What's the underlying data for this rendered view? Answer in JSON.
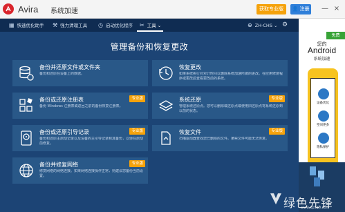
{
  "titlebar": {
    "app_name": "Avira",
    "app_subtitle": "系统加速",
    "pro_button": "获取专业版",
    "register_button": "注册",
    "minimize": "—",
    "close": "×"
  },
  "nav": {
    "items": [
      {
        "label": "快速优化助手",
        "icon": "grid-icon"
      },
      {
        "label": "强力清理工具",
        "icon": "broom-icon"
      },
      {
        "label": "启动优化程序",
        "icon": "timer-icon"
      },
      {
        "label": "工具",
        "icon": "tools-icon",
        "active": true
      }
    ],
    "language": "ZH-CHS",
    "settings_icon": "gear-icon"
  },
  "main": {
    "title": "管理备份和恢复更改",
    "cards": [
      {
        "title": "备份并还原文件或文件夹",
        "desc": "备份和还原在设备上的数据。",
        "badge": "",
        "icon": "database-icon"
      },
      {
        "title": "恢复更改",
        "desc": "如果系统执行对对计时间以删除系统加速所做的更改。在应用修复程序或更改后查看更改前的系统。",
        "badge": "",
        "icon": "restore-clock-icon"
      },
      {
        "title": "备份或还原注册表",
        "desc": "备份 Windows 注册表或返回之前的备份恢复注册表。",
        "badge": "专业版",
        "icon": "registry-icon"
      },
      {
        "title": "系统还原",
        "desc": "管理系统还原点。您可以删除或还原点或使用旧还原点将系统还原到以前的状态。",
        "badge": "专业版",
        "icon": "system-restore-icon"
      },
      {
        "title": "备份或还原引导记录",
        "desc": "备份和还原主启动记录以及设备的主引导记录和其备份，以便在启动前修复。",
        "badge": "专业版",
        "icon": "disk-icon"
      },
      {
        "title": "恢复文件",
        "desc": "扫描驱动器查找您已删除的文件。某些文件可能无法恢复。",
        "badge": "专业版",
        "icon": "file-recover-icon"
      },
      {
        "title": "备份并修复网络",
        "desc": "修复网络的网络连接。如果网络连接操作正常，则建议您备份当前设置。",
        "badge": "专业版",
        "icon": "network-globe-icon"
      }
    ]
  },
  "promo": {
    "free_tag": "免费",
    "line1": "您的",
    "line2": "Android",
    "line3": "系统加速",
    "phone_items": [
      {
        "label": "设备优化",
        "icon": "phone-optimize-icon"
      },
      {
        "label": "空间更多",
        "icon": "phone-storage-icon"
      },
      {
        "label": "隐私保护",
        "icon": "phone-privacy-icon"
      }
    ]
  },
  "watermark": {
    "text": "绿色先锋",
    "url": "www.xp510.com"
  },
  "colors": {
    "titlebar_bg": "#f4f4f4",
    "nav_bg": "#0f2c52",
    "main_bg": "#1c4475",
    "card_bg": "#295888",
    "badge_bg": "#f5a20b",
    "register_bg": "#2f7fd9",
    "brand_red": "#d9242b"
  }
}
